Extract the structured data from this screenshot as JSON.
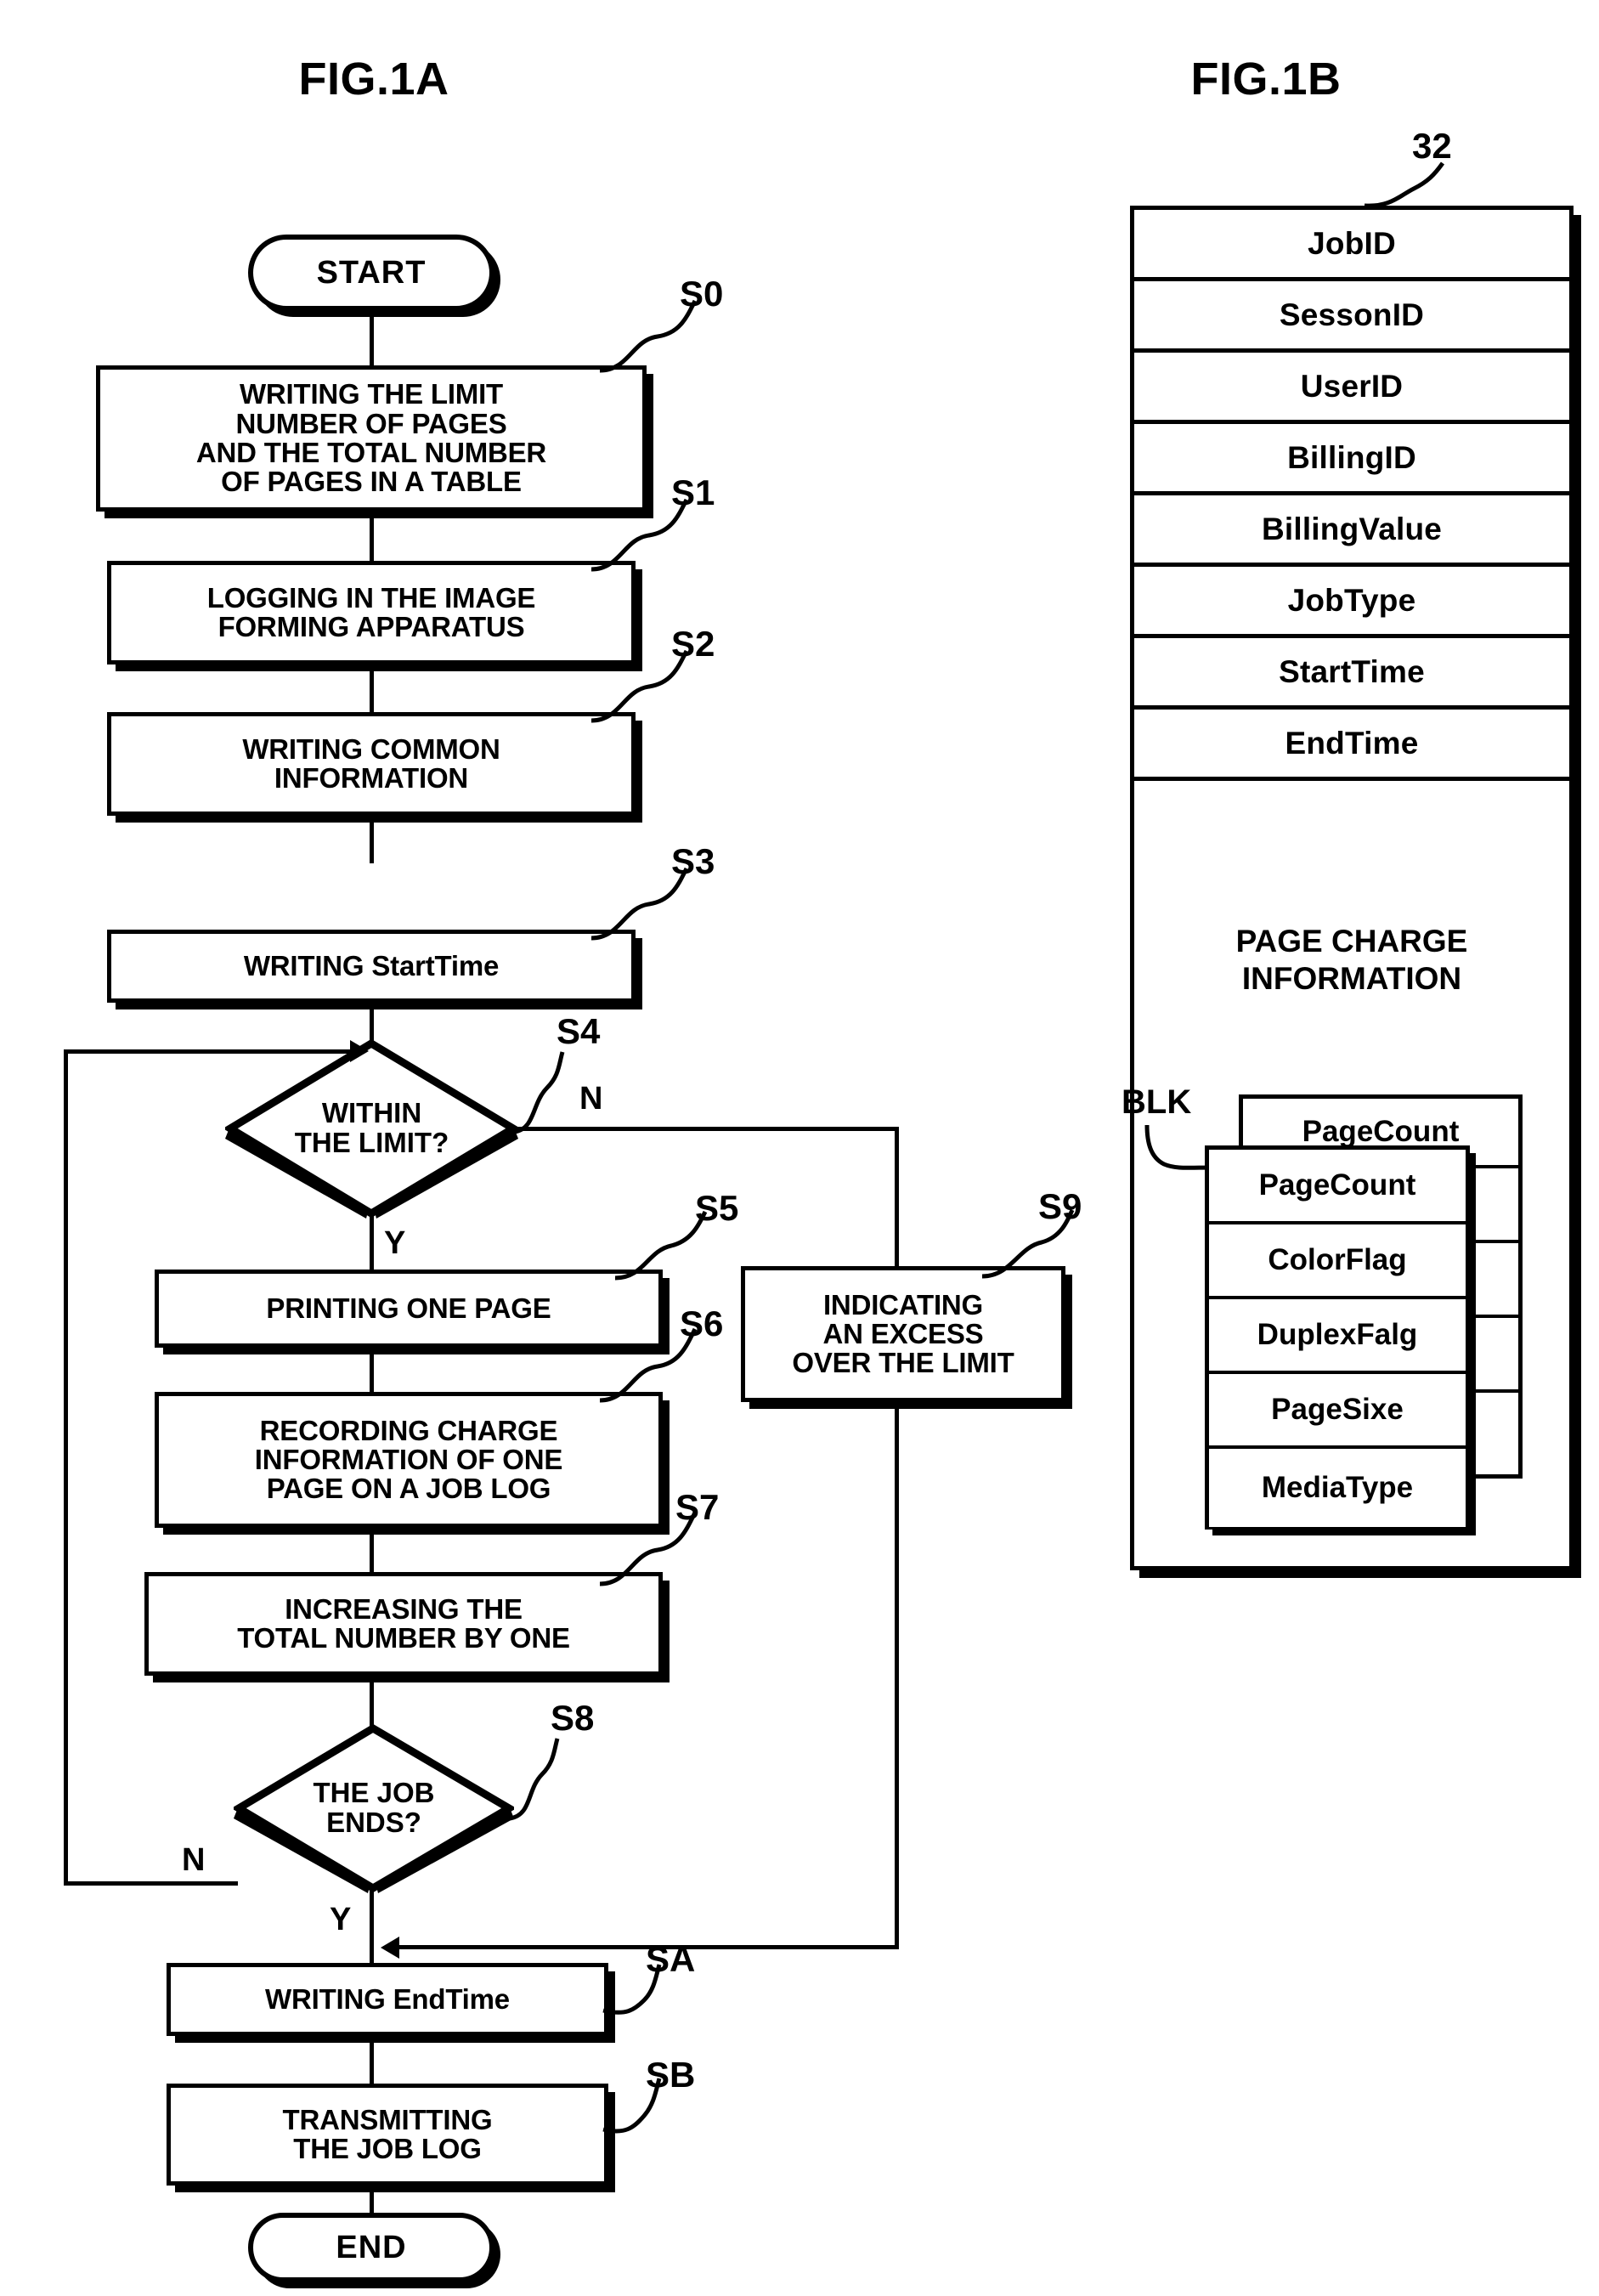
{
  "figures": {
    "left_title": "FIG.1A",
    "right_title": "FIG.1B"
  },
  "flowchart": {
    "start_label": "START",
    "end_label": "END",
    "yes_label": "Y",
    "no_label": "N",
    "steps": [
      {
        "id": "S0",
        "tag": "S0",
        "text": "WRITING THE LIMIT\nNUMBER OF PAGES\nAND THE TOTAL NUMBER\nOF PAGES IN A TABLE",
        "shape": "process"
      },
      {
        "id": "S1",
        "tag": "S1",
        "text": "LOGGING IN THE IMAGE\nFORMING APPARATUS",
        "shape": "process"
      },
      {
        "id": "S2",
        "tag": "S2",
        "text": "WRITING COMMON\nINFORMATION",
        "shape": "process"
      },
      {
        "id": "S3",
        "tag": "S3",
        "text": "WRITING StartTime",
        "shape": "process"
      },
      {
        "id": "S4",
        "tag": "S4",
        "text": "WITHIN\nTHE LIMIT?",
        "shape": "decision"
      },
      {
        "id": "S5",
        "tag": "S5",
        "text": "PRINTING ONE PAGE",
        "shape": "process"
      },
      {
        "id": "S6",
        "tag": "S6",
        "text": "RECORDING CHARGE\nINFORMATION OF ONE\nPAGE ON A JOB LOG",
        "shape": "process"
      },
      {
        "id": "S7",
        "tag": "S7",
        "text": "INCREASING THE\nTOTAL NUMBER BY ONE",
        "shape": "process"
      },
      {
        "id": "S8",
        "tag": "S8",
        "text": "THE JOB\nENDS?",
        "shape": "decision"
      },
      {
        "id": "S9",
        "tag": "S9",
        "text": "INDICATING\nAN EXCESS\nOVER THE LIMIT",
        "shape": "process"
      },
      {
        "id": "SA",
        "tag": "SA",
        "text": "WRITING EndTime",
        "shape": "process"
      },
      {
        "id": "SB",
        "tag": "SB",
        "text": "TRANSMITTING\nTHE JOB LOG",
        "shape": "process"
      }
    ]
  },
  "job_log": {
    "ref_number": "32",
    "blk_label": "BLK",
    "fields": [
      "JobID",
      "SessonID",
      "UserID",
      "BillingID",
      "BillingValue",
      "JobType",
      "StartTime",
      "EndTime"
    ],
    "page_charge_header": "PAGE CHARGE\nINFORMATION",
    "block_fields": [
      "PageCount",
      "ColorFlag",
      "DuplexFalg",
      "PageSixe",
      "MediaType"
    ],
    "back_card_top_field": "PageCount"
  }
}
